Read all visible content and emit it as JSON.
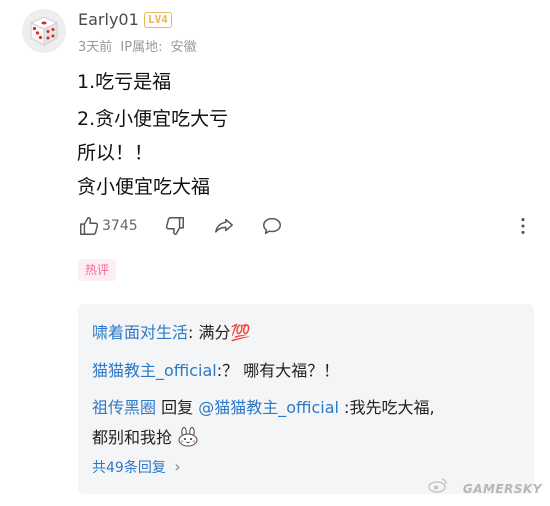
{
  "comment": {
    "username": "Early01",
    "level_badge": "LV4",
    "time_ago": "3天前",
    "ip_label": "IP属地:",
    "ip_location": "安徽",
    "lines": [
      "1.吃亏是福",
      "2.贪小便宜吃大亏",
      "所以！！",
      "贪小便宜吃大福"
    ]
  },
  "actions": {
    "like_count": "3745",
    "like_icon": "thumbs-up-icon",
    "dislike_icon": "thumbs-down-icon",
    "share_icon": "share-icon",
    "reply_icon": "comment-bubble-icon",
    "more_icon": "more-vertical-icon"
  },
  "tag": {
    "label": "热评"
  },
  "replies": {
    "items": [
      {
        "author": "啸着面对生活",
        "sep": ":",
        "text": " 满分",
        "emoji": "💯"
      },
      {
        "author": "猫猫教主_official",
        "sep": ":",
        "text": "？ 哪有大福？！"
      },
      {
        "author": "祖传黑圈",
        "reply_word": " 回复 ",
        "reply_to": "@猫猫教主_official",
        "sep": " :",
        "text": "我先吃大福,",
        "text2": "都别和我抢"
      }
    ],
    "more_label": "共49条回复",
    "more_chevron": "›"
  },
  "watermark": {
    "text": "GAMERSKY"
  },
  "colors": {
    "link_blue": "#2d79c7",
    "hot_tag_bg": "#fdeef3",
    "hot_tag_text": "#f06a8f",
    "badge": "#e6b85a",
    "reply_bg": "#f4f5f7"
  }
}
